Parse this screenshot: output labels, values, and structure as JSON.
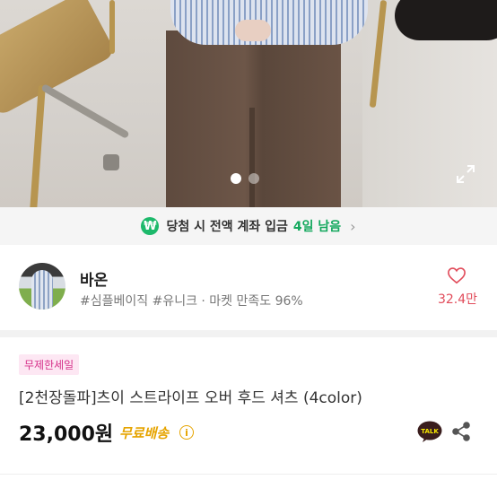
{
  "notice": {
    "icon_glyph": "₩",
    "text": "당첨 시 전액 계좌 입금",
    "days": "4일 남음",
    "chevron": "›",
    "accent": "#13a85d"
  },
  "carousel": {
    "total": 2,
    "active_index": 0
  },
  "seller": {
    "name": "바온",
    "meta": "#심플베이직 #유니크 · 마켓 만족도 96%",
    "likes": "32.4만"
  },
  "product": {
    "tag": "무제한세일",
    "title": "[2천장돌파]츠이 스트라이프 오버 후드 셔츠 (4color)",
    "price": "23,000원",
    "shipping": "무료배송",
    "info_glyph": "i"
  },
  "colors": {
    "like": "#e14b5a",
    "shipping": "#e6a400",
    "tag_text": "#d6308a",
    "tag_bg": "#fde7f3"
  }
}
